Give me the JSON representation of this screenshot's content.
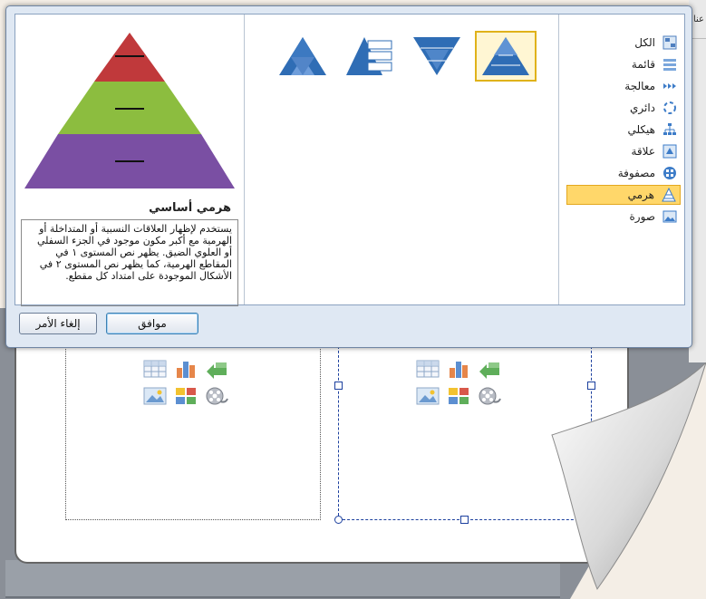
{
  "dialog": {
    "categories": [
      {
        "label": "الكل",
        "icon": "all-icon",
        "selected": false
      },
      {
        "label": "قائمة",
        "icon": "list-icon",
        "selected": false
      },
      {
        "label": "معالجة",
        "icon": "process-icon",
        "selected": false
      },
      {
        "label": "دائري",
        "icon": "cycle-icon",
        "selected": false
      },
      {
        "label": "هيكلي",
        "icon": "hierarchy-icon",
        "selected": false
      },
      {
        "label": "علاقة",
        "icon": "relationship-icon",
        "selected": false
      },
      {
        "label": "مصفوفة",
        "icon": "matrix-icon",
        "selected": false
      },
      {
        "label": "هرمي",
        "icon": "pyramid-icon",
        "selected": true
      },
      {
        "label": "صورة",
        "icon": "picture-icon",
        "selected": false
      }
    ],
    "gallery": [
      {
        "name": "basic-pyramid",
        "icon": "pyramid-layout-icon",
        "selected": true
      },
      {
        "name": "inverted-pyramid",
        "icon": "inverted-pyramid-icon",
        "selected": false
      },
      {
        "name": "pyramid-list",
        "icon": "pyramid-list-icon",
        "selected": false
      },
      {
        "name": "segmented-pyramid",
        "icon": "segmented-pyramid-icon",
        "selected": false
      }
    ],
    "preview": {
      "title": "هرمي أساسي",
      "description": "يستخدم لإظهار العلاقات النسبية أو المتداخلة أو الهرمية مع أكبر مكون موجود في الجزء السفلي أو العلوي الضيق. يظهر نص المستوى ١ في المقاطع الهرمية، كما يظهر نص المستوى ٢ في الأشكال الموجودة على امتداد كل مقطع."
    },
    "buttons": {
      "ok": "موافق",
      "cancel": "إلغاء الأمر"
    }
  },
  "background": {
    "edge_text": "عنا"
  },
  "colors": {
    "selection": "#ffd76a",
    "pyramid_top": "#c0393b",
    "pyramid_mid": "#8cbd3f",
    "pyramid_bottom": "#7a4fa3",
    "accent_blue": "#2f6db5"
  }
}
